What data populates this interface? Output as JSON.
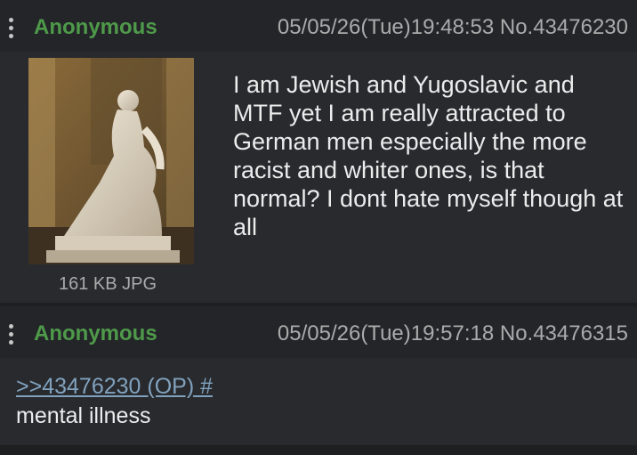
{
  "posts": [
    {
      "name": "Anonymous",
      "datetime": "05/05/26(Tue)19:48:53",
      "post_no": "No.43476230",
      "file_info": "161 KB JPG",
      "image_icon": "statue-image",
      "body": "I am Jewish and Yugoslavic and MTF yet I am really attracted to German men especially the more racist and whiter ones, is that normal? I dont hate myself though at all"
    },
    {
      "name": "Anonymous",
      "datetime": "05/05/26(Tue)19:57:18",
      "post_no": "No.43476315",
      "quote_link": ">>43476230 (OP) #",
      "body": "mental illness"
    }
  ],
  "colors": {
    "background": "#1d1f21",
    "post_bg": "#282a2e",
    "name": "#4f9a4a",
    "link": "#81a2be"
  }
}
